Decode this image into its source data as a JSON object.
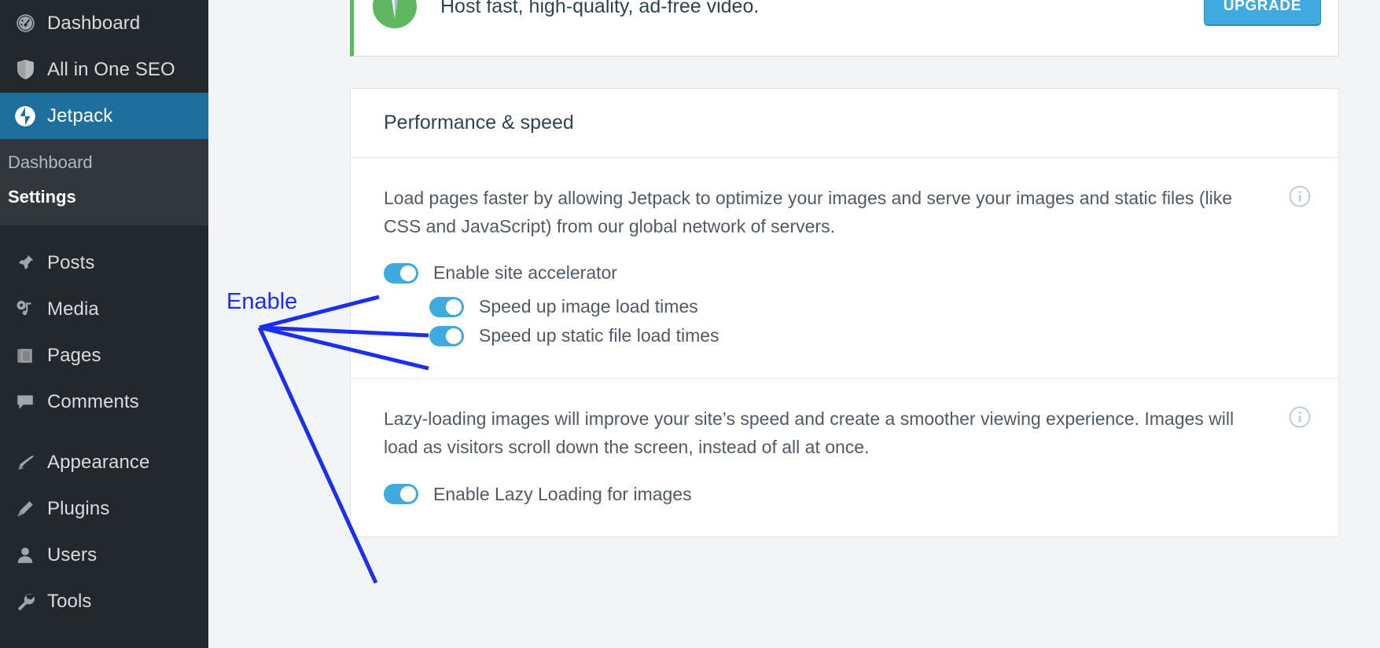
{
  "sidebar": {
    "items": [
      {
        "label": "Dashboard",
        "icon": "dashboard-icon",
        "active": false
      },
      {
        "label": "All in One SEO",
        "icon": "shield-icon",
        "active": false
      },
      {
        "label": "Jetpack",
        "icon": "jetpack-icon",
        "active": true
      }
    ],
    "submenu": [
      {
        "label": "Dashboard",
        "current": false
      },
      {
        "label": "Settings",
        "current": true
      }
    ],
    "items_lower": [
      {
        "label": "Posts",
        "icon": "pin-icon"
      },
      {
        "label": "Media",
        "icon": "media-icon"
      },
      {
        "label": "Pages",
        "icon": "pages-icon"
      },
      {
        "label": "Comments",
        "icon": "comment-icon"
      },
      {
        "label": "Appearance",
        "icon": "paintbrush-icon"
      },
      {
        "label": "Plugins",
        "icon": "plug-icon"
      },
      {
        "label": "Users",
        "icon": "user-icon"
      },
      {
        "label": "Tools",
        "icon": "wrench-icon"
      }
    ]
  },
  "promo": {
    "text": "Host fast, high-quality, ad-free video.",
    "button_label": "UPGRADE",
    "icon": "video-pencil-icon",
    "accent_color": "#5cb85c",
    "button_color": "#3eaadf"
  },
  "card": {
    "title": "Performance & speed",
    "sections": [
      {
        "description": "Load pages faster by allowing Jetpack to optimize your images and serve your images and static files (like CSS and JavaScript) from our global network of servers.",
        "info_icon": "info-icon",
        "toggles": [
          {
            "label": "Enable site accelerator",
            "on": true
          },
          {
            "label": "Speed up image load times",
            "on": true
          },
          {
            "label": "Speed up static file load times",
            "on": true
          }
        ]
      },
      {
        "description": "Lazy-loading images will improve your site’s speed and create a smoother viewing experience. Images will load as visitors scroll down the screen, instead of all at once.",
        "info_icon": "info-icon",
        "toggles": [
          {
            "label": "Enable Lazy Loading for images",
            "on": true
          }
        ]
      }
    ]
  },
  "annotation": {
    "label": "Enable",
    "color": "#1a2ef0"
  },
  "colors": {
    "sidebar_bg": "#23282d",
    "sidebar_submenu_bg": "#32373c",
    "sidebar_active_bg": "#1f6f9e",
    "page_bg": "#f1f5f8",
    "toggle_on": "#3eaadf",
    "text": "#4f5a66"
  }
}
